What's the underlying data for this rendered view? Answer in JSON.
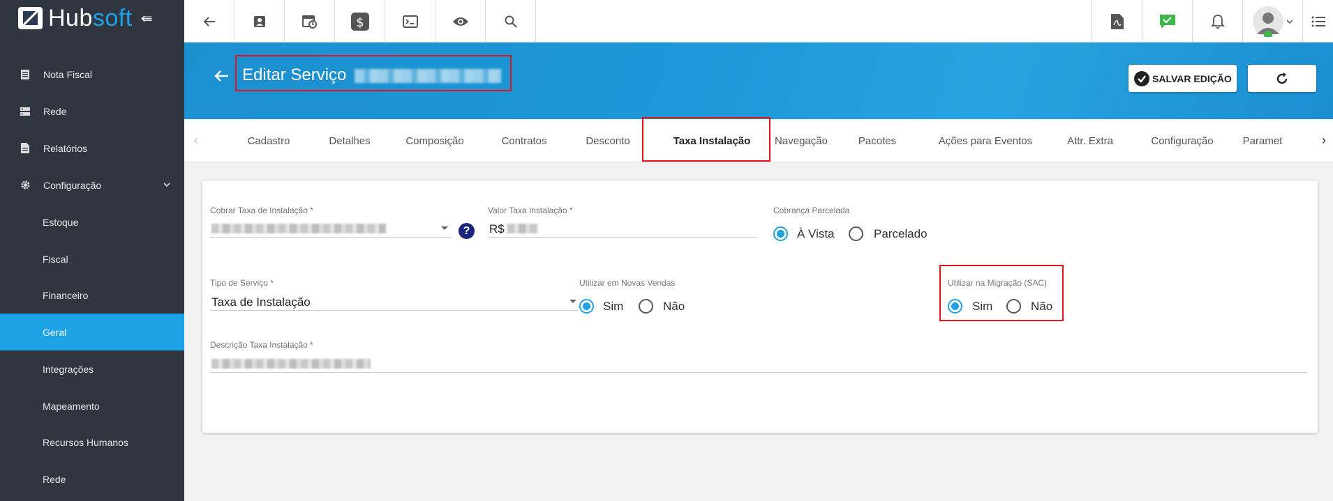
{
  "brand": {
    "name_part1": "Hub",
    "name_part2": "soft"
  },
  "sidebar": {
    "items": [
      {
        "label": "Nota Fiscal",
        "icon": "document-icon"
      },
      {
        "label": "Rede",
        "icon": "server-icon"
      },
      {
        "label": "Relatórios",
        "icon": "report-icon"
      },
      {
        "label": "Configuração",
        "icon": "gear-icon"
      },
      {
        "label": "Estoque"
      },
      {
        "label": "Fiscal"
      },
      {
        "label": "Financeiro"
      },
      {
        "label": "Geral"
      },
      {
        "label": "Integrações"
      },
      {
        "label": "Mapeamento"
      },
      {
        "label": "Recursos Humanos"
      },
      {
        "label": "Rede"
      }
    ],
    "active": "Geral",
    "accent": "#1ea2e6"
  },
  "header": {
    "title": "Editar Serviço",
    "save_label": "SALVAR EDIÇÃO"
  },
  "tabs": [
    "Cadastro",
    "Detalhes",
    "Composição",
    "Contratos",
    "Desconto",
    "Taxa Instalação",
    "Navegação",
    "Pacotes",
    "Ações para Eventos",
    "Attr. Extra",
    "Configuração",
    "Paramet"
  ],
  "active_tab": "Taxa Instalação",
  "form": {
    "cobrar_label": "Cobrar Taxa de Instalação *",
    "valor_label": "Valor Taxa Instalação *",
    "valor_prefix": "R$",
    "cobranca_label": "Cobrança Parcelada",
    "cobranca_opt1": "À Vista",
    "cobranca_opt2": "Parcelado",
    "cobranca_selected": "À Vista",
    "tipo_label": "Tipo de Serviço *",
    "tipo_value": "Taxa de Instalação",
    "novas_label": "Utilizar em Novas Vendas",
    "novas_opt1": "Sim",
    "novas_opt2": "Não",
    "novas_selected": "Sim",
    "migracao_label": "Utilizar na Migração (SAC)",
    "migracao_opt1": "Sim",
    "migracao_opt2": "Não",
    "migracao_selected": "Sim",
    "descricao_label": "Descrição Taxa Instalação *"
  },
  "colors": {
    "header_blue": "#1d98d8",
    "highlight_red": "#e3141b",
    "radio_blue": "#1ea2e6"
  }
}
